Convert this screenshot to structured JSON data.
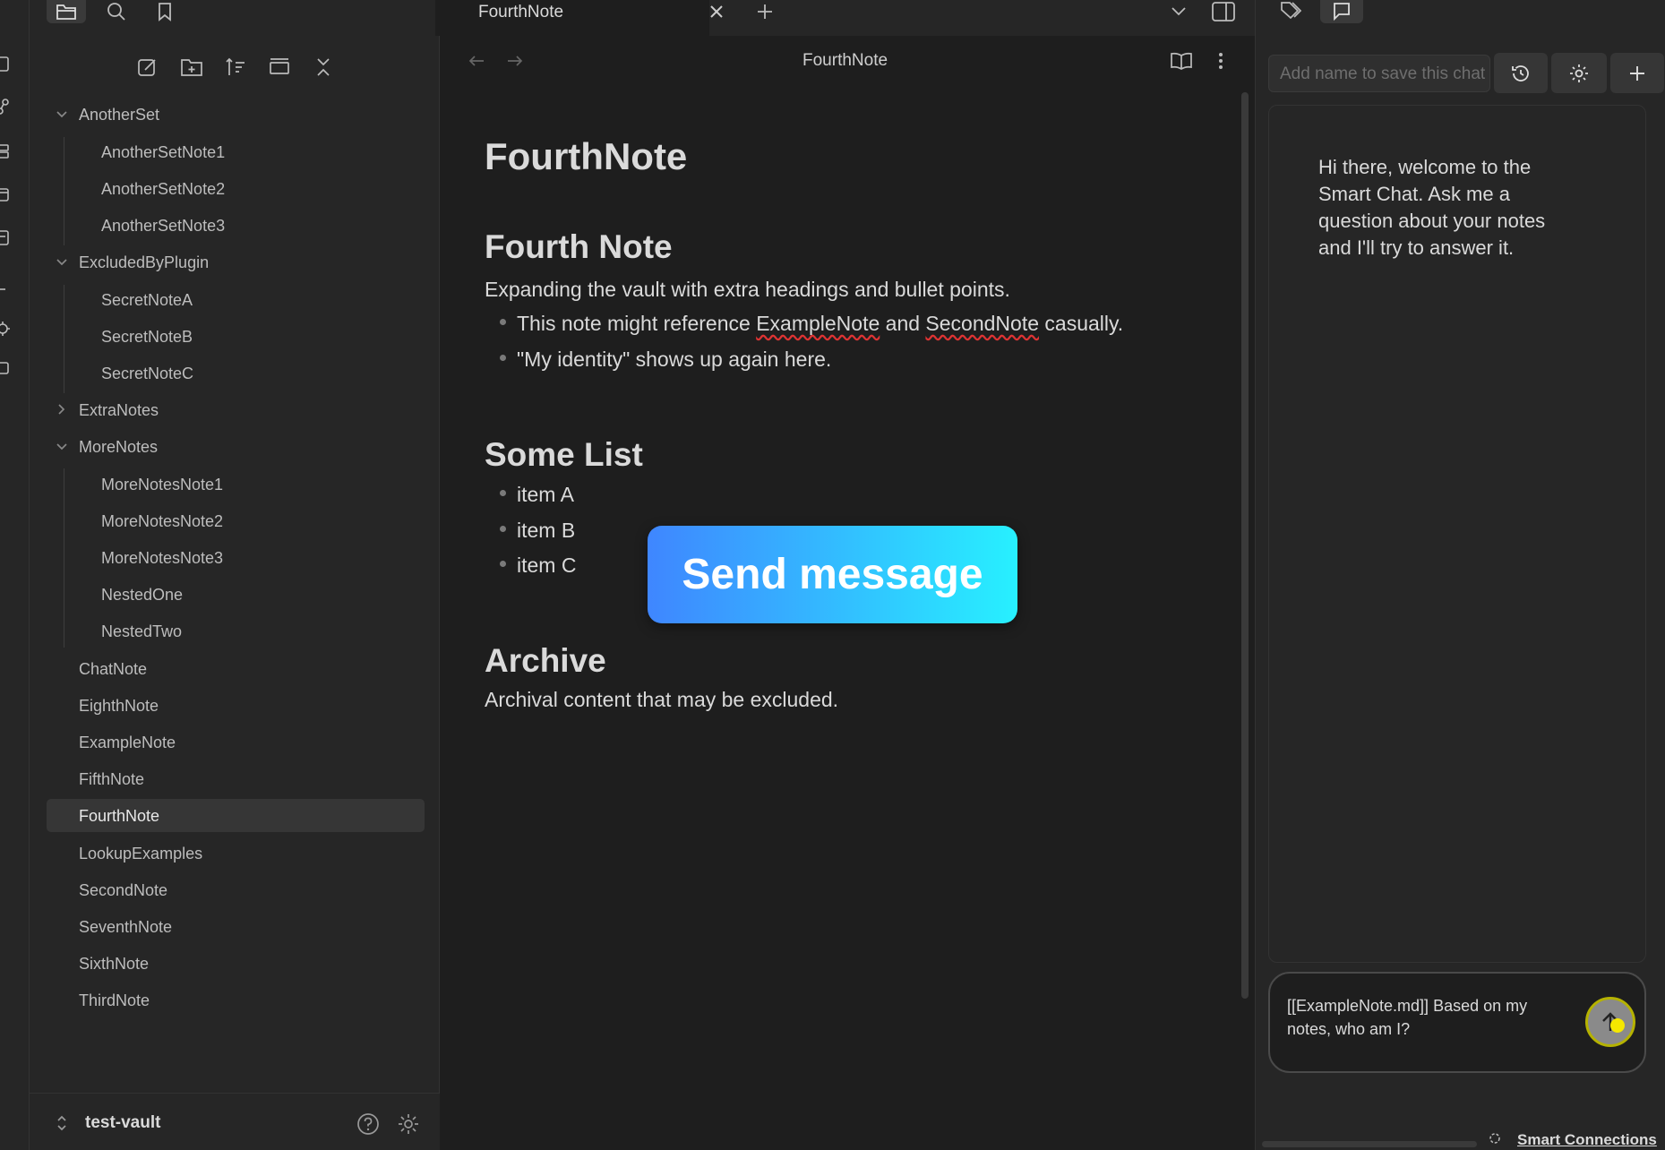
{
  "tabs": {
    "active_title": "FourthNote",
    "icons": [
      "files-icon",
      "search-icon",
      "bookmark-icon",
      "close-icon",
      "new-tab-icon",
      "tab-list-icon",
      "sidebar-toggle-icon"
    ]
  },
  "explorer": {
    "toolbar_icons": [
      "new-note-icon",
      "new-folder-icon",
      "sort-icon",
      "auto-reveal-icon",
      "collapse-all-icon"
    ],
    "folders": [
      {
        "name": "AnotherSet",
        "expanded": true,
        "children": [
          "AnotherSetNote1",
          "AnotherSetNote2",
          "AnotherSetNote3"
        ]
      },
      {
        "name": "ExcludedByPlugin",
        "expanded": true,
        "children": [
          "SecretNoteA",
          "SecretNoteB",
          "SecretNoteC"
        ]
      },
      {
        "name": "ExtraNotes",
        "expanded": false,
        "children": []
      },
      {
        "name": "MoreNotes",
        "expanded": true,
        "children": [
          "MoreNotesNote1",
          "MoreNotesNote2",
          "MoreNotesNote3",
          "NestedOne",
          "NestedTwo"
        ]
      }
    ],
    "files": [
      "ChatNote",
      "EighthNote",
      "ExampleNote",
      "FifthNote",
      "FourthNote",
      "LookupExamples",
      "SecondNote",
      "SeventhNote",
      "SixthNote",
      "ThirdNote"
    ],
    "active_file": "FourthNote",
    "vault_name": "test-vault"
  },
  "editor": {
    "header_title": "FourthNote",
    "title": "FourthNote",
    "h_fourth": "Fourth Note",
    "intro": "Expanding the vault with extra headings and bullet points.",
    "bullets1": {
      "b1_pre": "This note might reference ",
      "b1_link1": "ExampleNote",
      "b1_mid": " and ",
      "b1_link2": "SecondNote",
      "b1_post": " casually.",
      "b2": "\"My identity\" shows up again here."
    },
    "h_list": "Some List",
    "list": [
      "item A",
      "item B",
      "item C"
    ],
    "h_archive": "Archive",
    "archive_text": "Archival content that may be excluded."
  },
  "overlay": {
    "send_label": "Send message"
  },
  "chat": {
    "name_placeholder": "Add name to save this chat",
    "welcome": "Hi there, welcome to the Smart Chat. Ask me a question about your notes and I'll try to answer it.",
    "input_text": "[[ExampleNote.md]] Based on my notes, who am I?",
    "status_label": "Smart Connections"
  },
  "colors": {
    "accent_start": "#3f86ff",
    "accent_end": "#27f0ff",
    "cursor": "#f5e800"
  }
}
